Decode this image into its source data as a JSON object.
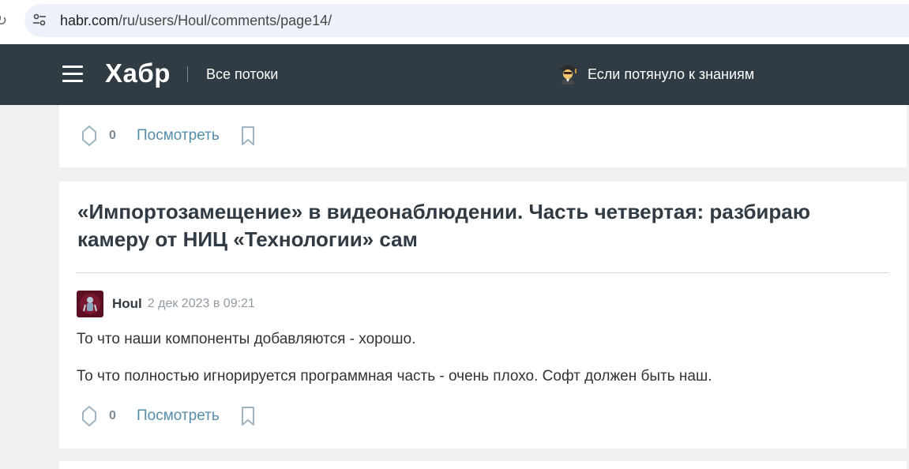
{
  "browser": {
    "url_host": "habr.com",
    "url_path": "/ru/users/Houl/comments/page14/"
  },
  "header": {
    "logo": "Хабр",
    "all_streams": "Все потоки",
    "promo_text": "Если потянуло к знаниям"
  },
  "top_card": {
    "vote_count": "0",
    "view_label": "Посмотреть"
  },
  "post": {
    "title": "«Импортозамещение» в видеонаблюдении. Часть четвертая: разбираю камеру от НИЦ «Технологии» сам",
    "comment": {
      "author": "Houl",
      "time": "2 дек 2023 в 09:21",
      "paragraphs": [
        "То что наши компоненты добавляются - хорошо.",
        "То что полностью игнорируется программная часть - очень плохо. Софт должен быть наш."
      ]
    },
    "vote_count": "0",
    "view_label": "Посмотреть"
  },
  "colors": {
    "header_bg": "#303b44",
    "link": "#548eaa",
    "muted": "#7a8b96"
  }
}
